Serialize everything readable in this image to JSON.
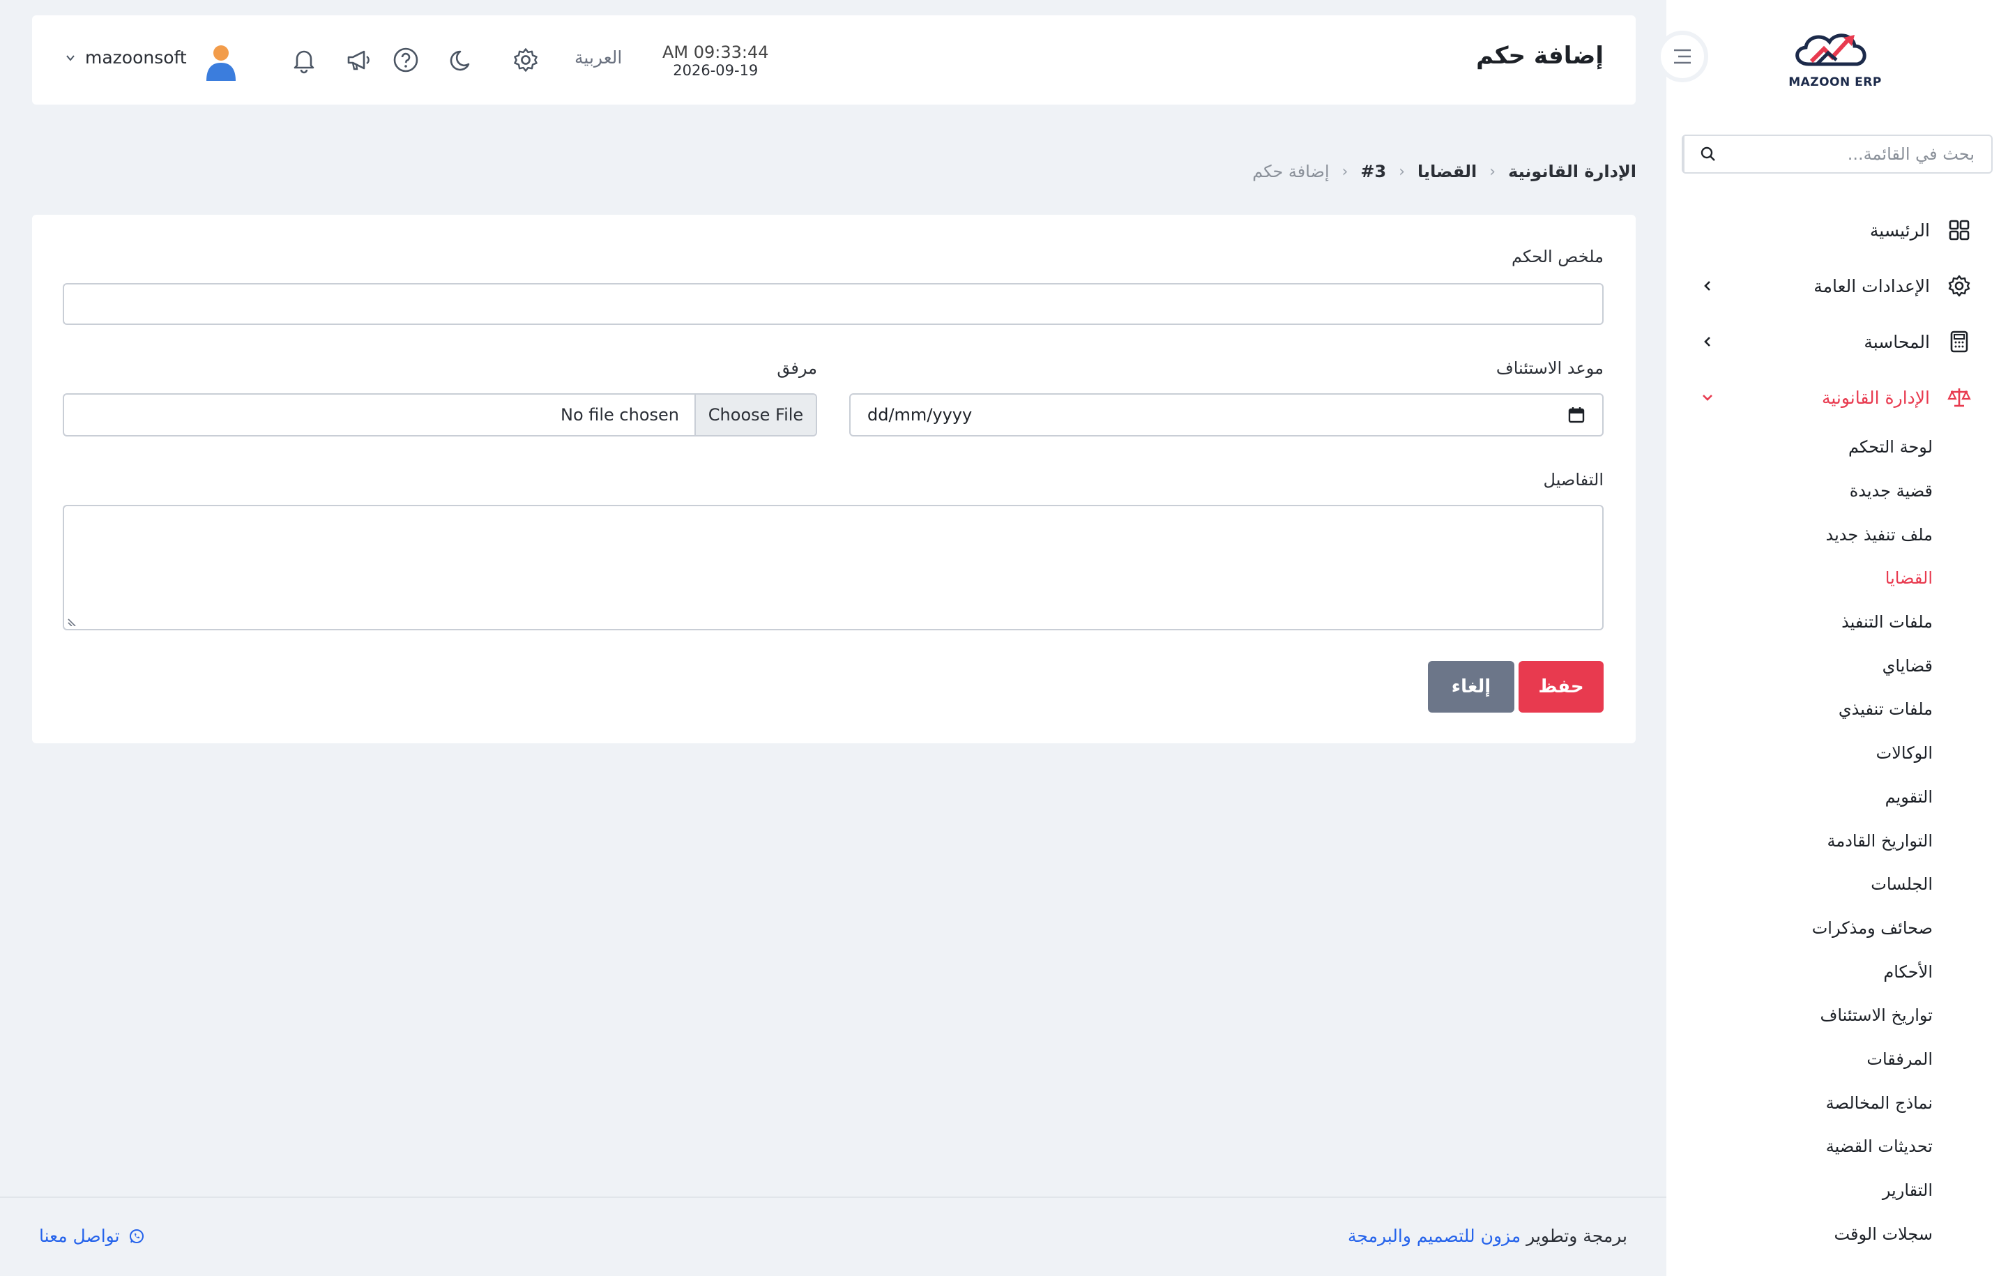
{
  "brand": {
    "name": "MAZOON ERP"
  },
  "search": {
    "placeholder": "بحث في القائمة..."
  },
  "nav": {
    "home": "الرئيسية",
    "general_settings": "الإعدادات العامة",
    "accounting": "المحاسبة",
    "legal": "الإدارة القانونية",
    "legal_items": [
      "لوحة التحكم",
      "قضية جديدة",
      "ملف تنفيذ جديد",
      "القضايا",
      "ملفات التنفيذ",
      "قضاياي",
      "ملفات تنفيذي",
      "الوكالات",
      "التقويم",
      "التواريخ القادمة",
      "الجلسات",
      "صحائف ومذكرات",
      "الأحكام",
      "تواريخ الاستئناف",
      "المرفقات",
      "نماذج المخالصة",
      "تحديثات القضية",
      "التقارير",
      "سجلات الوقت"
    ],
    "active_sub": "القضايا"
  },
  "topbar": {
    "title": "إضافة حكم",
    "time": "AM 09:33:44",
    "date": "2026-09-19",
    "language": "العربية",
    "username": "mazoonsoft"
  },
  "breadcrumb": {
    "items": [
      "الإدارة القانونية",
      "القضايا",
      "#3"
    ],
    "current": "إضافة حكم"
  },
  "form": {
    "summary_label": "ملخص الحكم",
    "summary_value": "",
    "appeal_label": "موعد الاستئناف",
    "appeal_value": "dd/mm/yyyy",
    "attachment_label": "مرفق",
    "choose_file": "Choose File",
    "no_file": "No file chosen",
    "details_label": "التفاصيل",
    "details_value": "",
    "save": "حفظ",
    "cancel": "إلغاء"
  },
  "footer": {
    "credit_prefix": "برمجة وتطوير",
    "credit_link": "مزون للتصميم والبرمجة",
    "contact": "تواصل معنا"
  },
  "colors": {
    "accent": "#e83a4f",
    "background": "#eff2f6",
    "link": "#2563eb",
    "cancel": "#6c7689"
  }
}
